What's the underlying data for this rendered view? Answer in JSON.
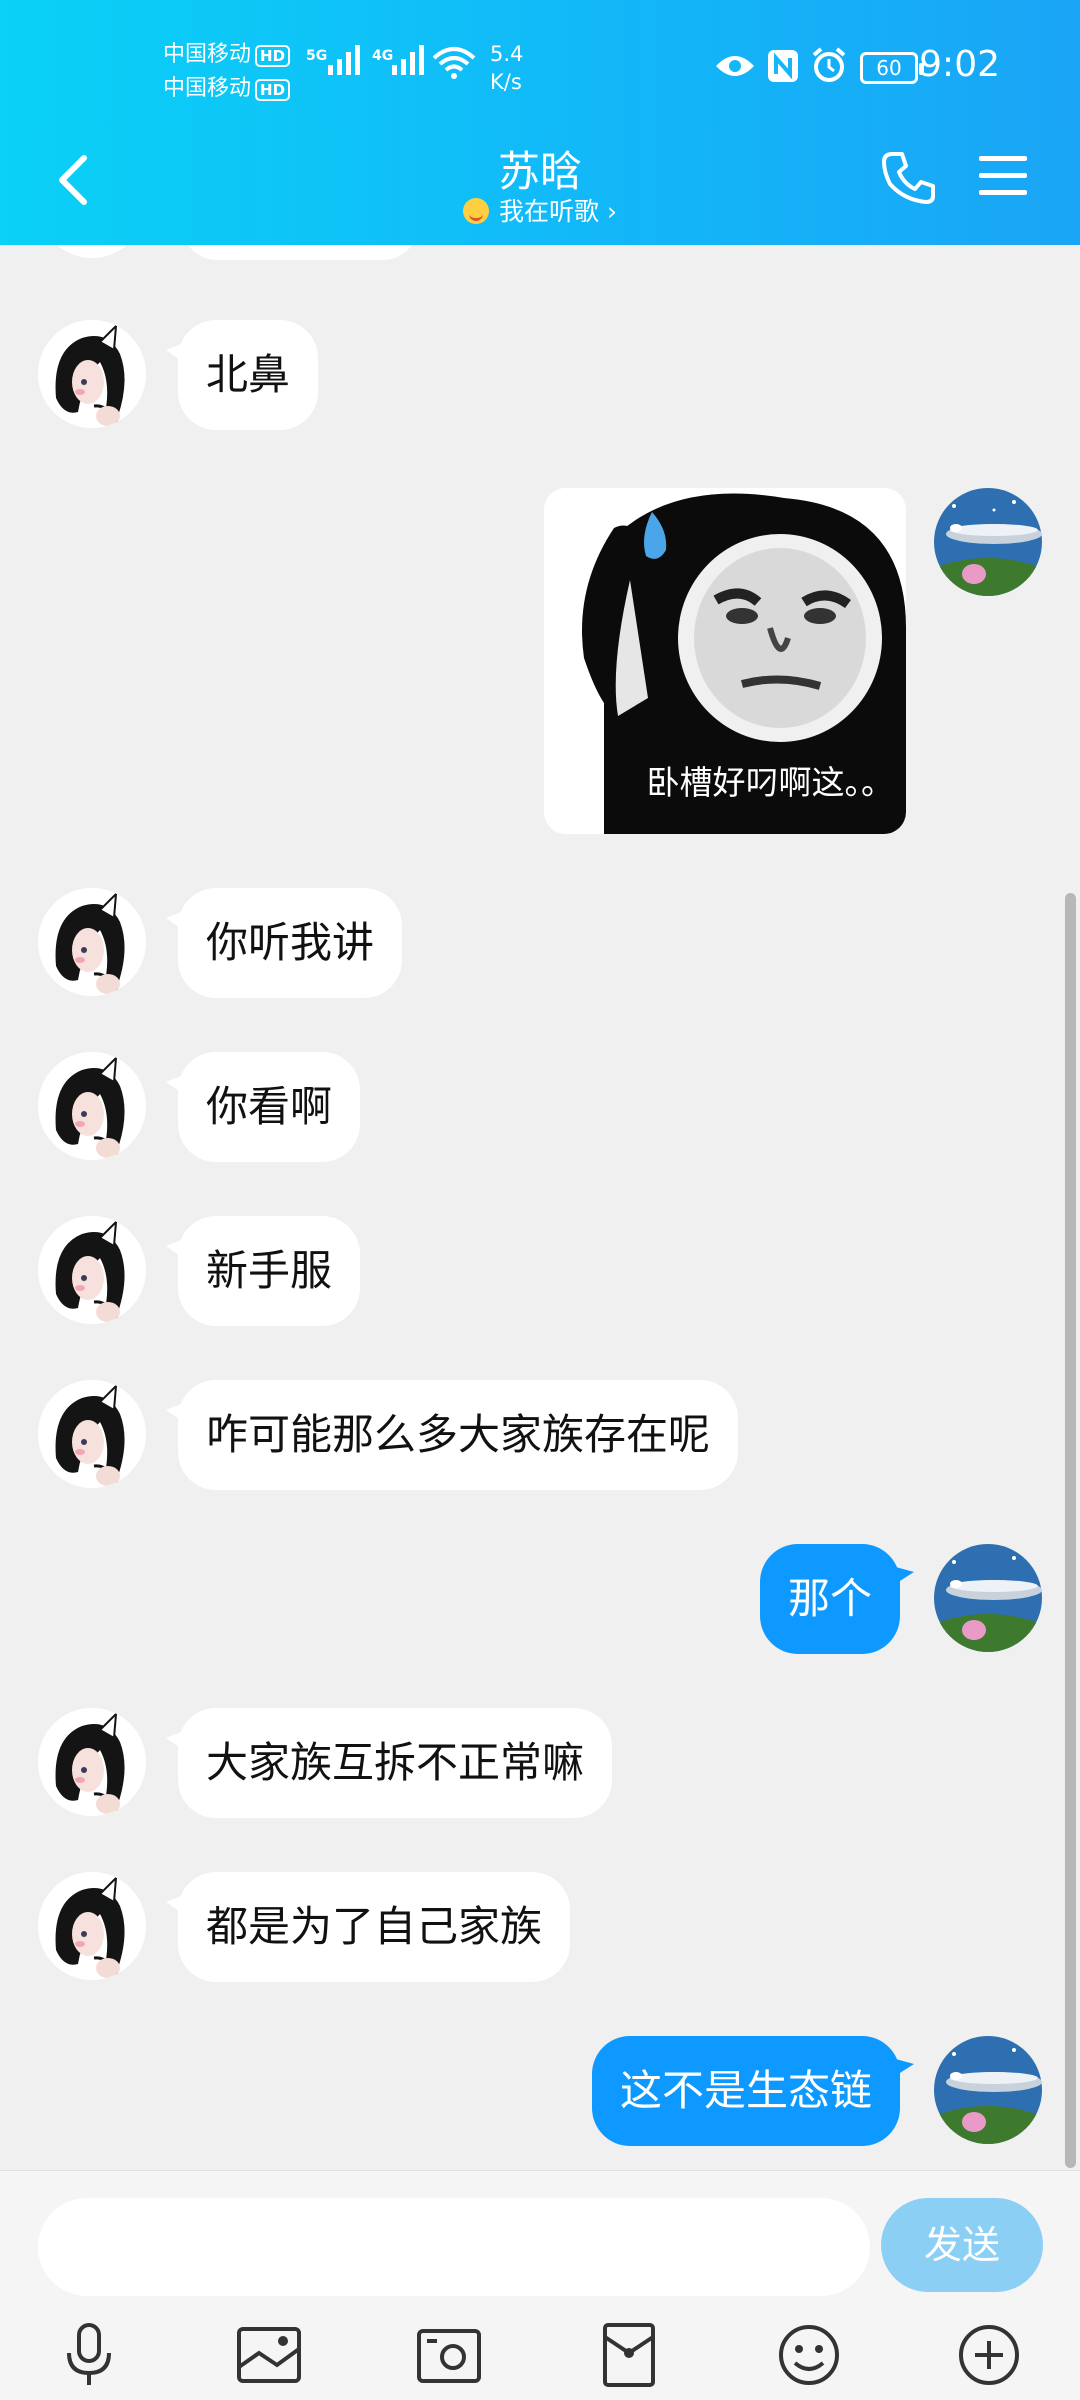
{
  "status_bar": {
    "carrier1": "中国移动",
    "carrier2": "中国移动",
    "hd": "HD",
    "net1": "5G",
    "net2": "4G",
    "speed_value": "5.4",
    "speed_unit": "K/s",
    "battery": "60",
    "time": "9:02"
  },
  "header": {
    "title": "苏晗",
    "subtitle": "我在听歌 ›"
  },
  "messages": [
    {
      "side": "in",
      "text": "北鼻"
    },
    {
      "side": "out",
      "type": "sticker",
      "caption": "卧槽好叼啊这。。"
    },
    {
      "side": "in",
      "text": "你听我讲"
    },
    {
      "side": "in",
      "text": "你看啊"
    },
    {
      "side": "in",
      "text": "新手服"
    },
    {
      "side": "in",
      "text": "咋可能那么多大家族存在呢"
    },
    {
      "side": "out",
      "text": "那个"
    },
    {
      "side": "in",
      "text": "大家族互拆不正常嘛"
    },
    {
      "side": "in",
      "text": "都是为了自己家族"
    },
    {
      "side": "out",
      "text": "这不是生态链"
    }
  ],
  "input": {
    "value": "",
    "send_label": "发送"
  },
  "toolbar": [
    "mic-icon",
    "image-icon",
    "camera-icon",
    "red-packet-icon",
    "emoji-icon",
    "plus-icon"
  ],
  "colors": {
    "header_start": "#0ad1f6",
    "header_end": "#1aa5f6",
    "outgoing_bubble": "#0d99ff",
    "send_button": "#8ccff5",
    "background": "#f0f0f0"
  }
}
